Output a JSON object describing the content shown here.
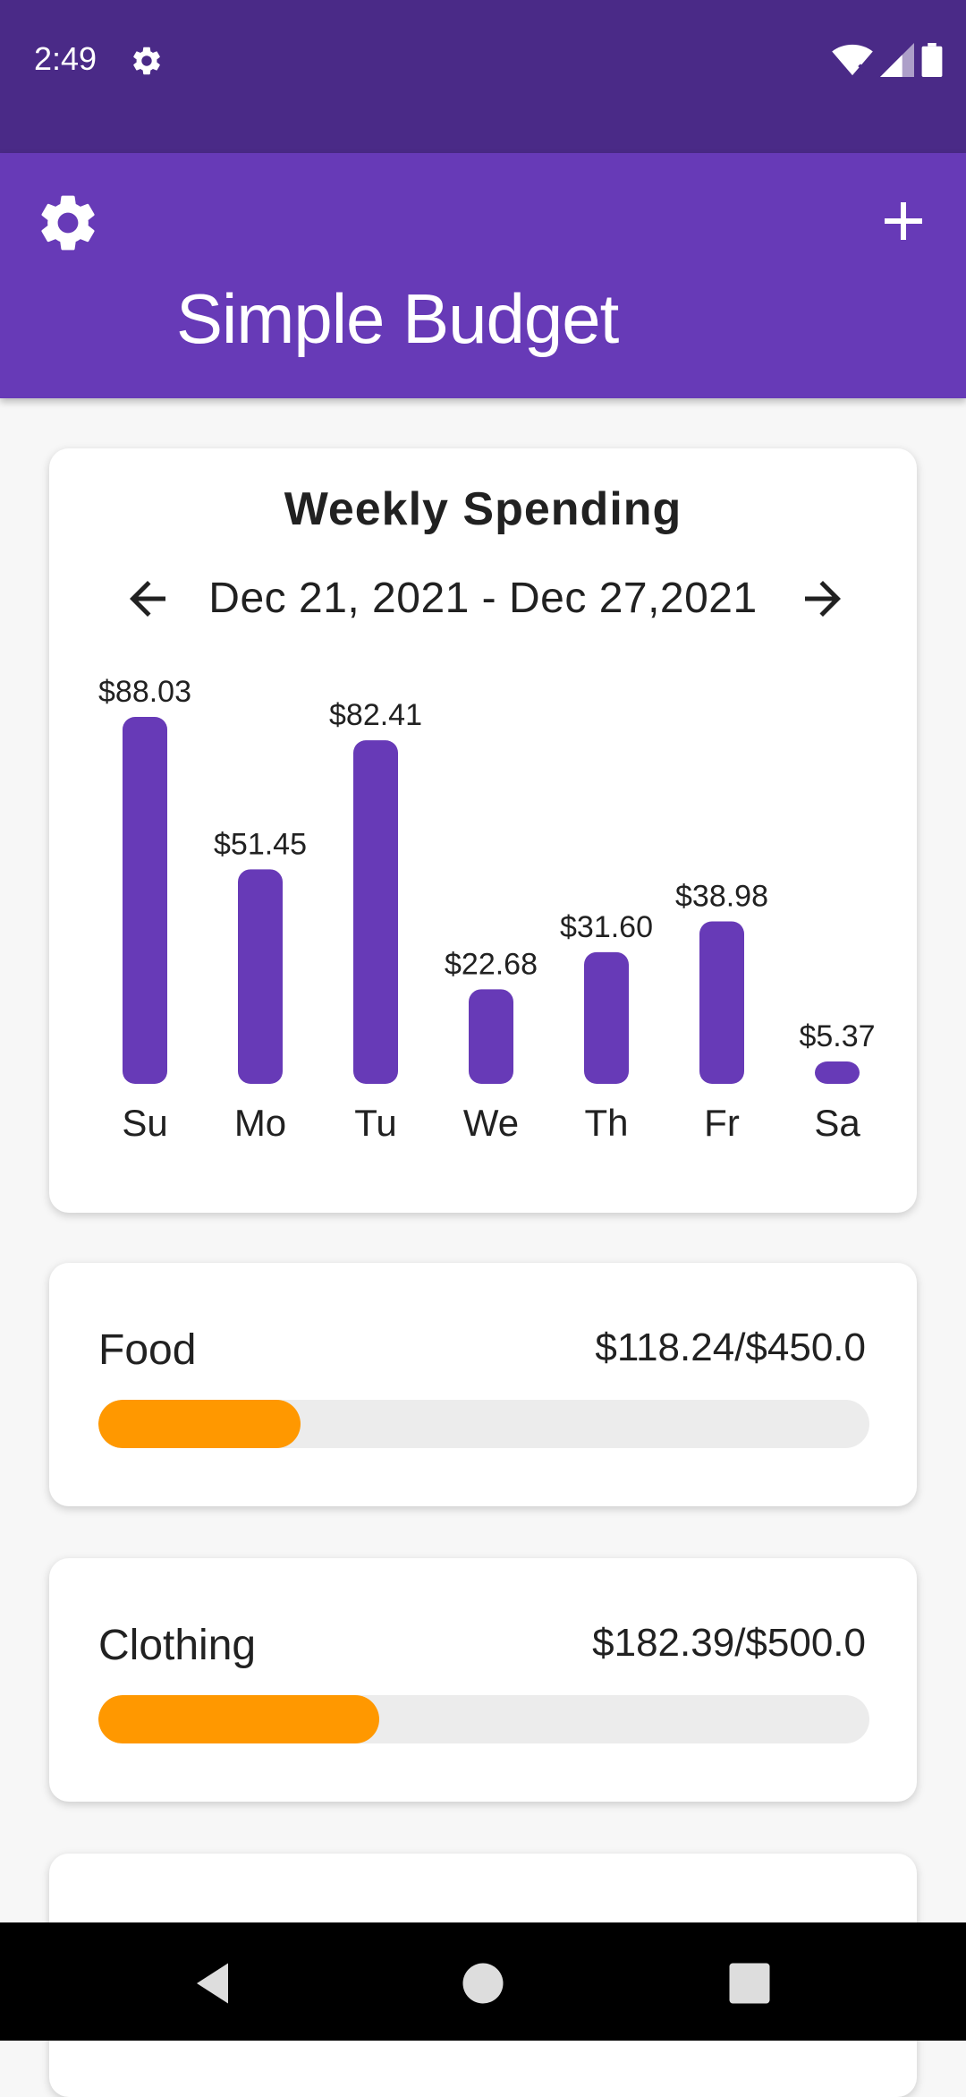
{
  "status_bar": {
    "time": "2:49",
    "icons": [
      "gear-icon",
      "wifi-icon",
      "signal-icon",
      "battery-icon"
    ]
  },
  "app_bar": {
    "title": "Simple Budget",
    "settings_icon": "gear-icon",
    "add_icon": "plus-icon"
  },
  "weekly": {
    "title": "Weekly Spending",
    "range": "Dec 21, 2021 - Dec 27,2021",
    "prev_icon": "arrow-left-icon",
    "next_icon": "arrow-right-icon"
  },
  "chart_data": {
    "type": "bar",
    "categories": [
      "Su",
      "Mo",
      "Tu",
      "We",
      "Th",
      "Fr",
      "Sa"
    ],
    "values": [
      88.03,
      51.45,
      82.41,
      22.68,
      31.6,
      38.98,
      5.37
    ],
    "value_labels": [
      "$88.03",
      "$51.45",
      "$82.41",
      "$22.68",
      "$31.60",
      "$38.98",
      "$5.37"
    ],
    "title": "",
    "xlabel": "",
    "ylabel": "",
    "color": "#673ab7"
  },
  "budgets": [
    {
      "name": "Food",
      "amount": "$118.24/$450.0",
      "spent": 118.24,
      "limit": 450.0
    },
    {
      "name": "Clothing",
      "amount": "$182.39/$500.0",
      "spent": 182.39,
      "limit": 500.0
    }
  ],
  "colors": {
    "status_bar": "#4a2a87",
    "app_bar": "#673ab7",
    "bar": "#673ab7",
    "progress": "#ff9800",
    "track": "#ececec"
  },
  "nav_bar": {
    "icons": [
      "back-icon",
      "home-icon",
      "recents-icon"
    ]
  }
}
